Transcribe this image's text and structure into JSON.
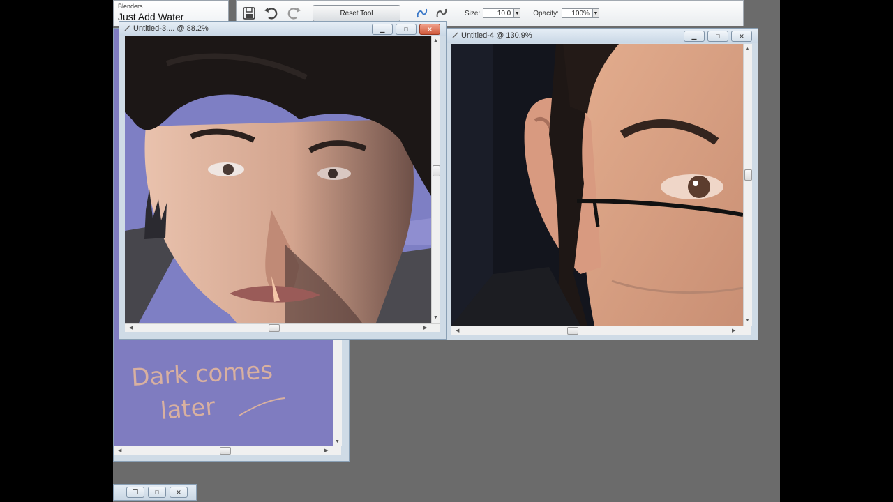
{
  "tool_panel": {
    "category": "Blenders",
    "tool_name": "Just Add Water"
  },
  "toolbar": {
    "reset_label": "Reset Tool",
    "size_label": "Size:",
    "size_value": "10.0",
    "opacity_label": "Opacity:",
    "opacity_value": "100%"
  },
  "windows": {
    "left": {
      "title": "Untitled-3.... @ 88.2%"
    },
    "right": {
      "title": "Untitled-4 @ 130.9%"
    }
  },
  "note": {
    "line1": "Dark comes",
    "line2": "later"
  },
  "icons": [
    "save-icon",
    "undo-icon",
    "redo-icon",
    "brush-stroke-icon",
    "brush-stroke-alt-icon",
    "minimize-icon",
    "maximize-icon",
    "close-icon",
    "restore-icon"
  ],
  "colors": {
    "workspace": "#6b6b6b",
    "note_canvas": "#7f7cc0",
    "note_ink": "#d8b0a0",
    "window_frame": "#cfdbe6"
  }
}
